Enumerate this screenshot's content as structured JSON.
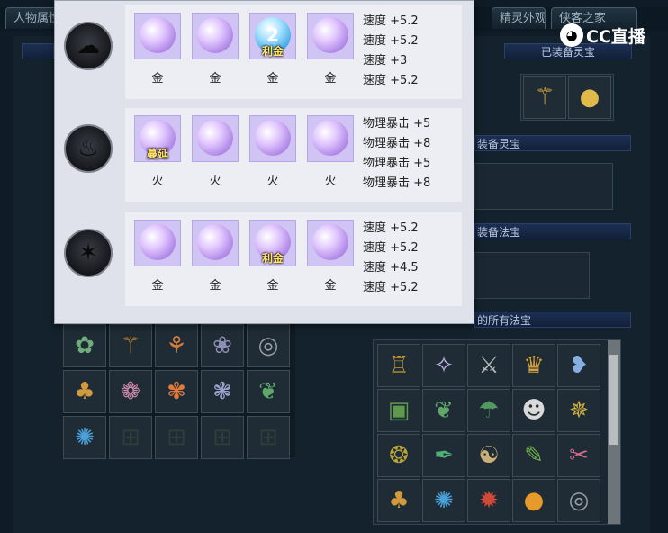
{
  "tabs": [
    "人物属性",
    "",
    "精灵外观",
    "侠客之家"
  ],
  "right_panel": {
    "equipped_lingbao_header": "已装备灵宝",
    "equip_lingbao_header": "装备灵宝",
    "equip_fabao_header": "装备法宝",
    "all_fabao_header": "的所有法宝"
  },
  "logo": {
    "text": "CC直播"
  },
  "popup": {
    "rows": [
      {
        "element_icon": "cloud-element-icon",
        "gems": [
          {
            "label": "金",
            "tag": "",
            "icon": "purple-orb-icon"
          },
          {
            "label": "金",
            "tag": "",
            "icon": "purple-orb-icon"
          },
          {
            "label": "金",
            "tag": "利金",
            "badge": "2",
            "icon": "blue-orb-icon"
          },
          {
            "label": "金",
            "tag": "",
            "icon": "purple-orb-icon"
          }
        ],
        "stats": [
          "速度 +5.2",
          "速度 +5.2",
          "速度 +3",
          "速度 +5.2"
        ]
      },
      {
        "element_icon": "fire-element-icon",
        "gems": [
          {
            "label": "火",
            "tag": "蔓延",
            "icon": "white-orb-icon"
          },
          {
            "label": "火",
            "tag": "",
            "icon": "purple-orb-icon"
          },
          {
            "label": "火",
            "tag": "",
            "icon": "purple-orb-icon"
          },
          {
            "label": "火",
            "tag": "",
            "icon": "purple-orb-icon"
          }
        ],
        "stats": [
          "物理暴击 +5",
          "物理暴击 +8",
          "物理暴击 +5",
          "物理暴击 +8"
        ]
      },
      {
        "element_icon": "fish-element-icon",
        "gems": [
          {
            "label": "金",
            "tag": "",
            "icon": "purple-orb-icon"
          },
          {
            "label": "金",
            "tag": "",
            "icon": "purple-orb-icon"
          },
          {
            "label": "金",
            "tag": "利金",
            "icon": "purple-orb-icon"
          },
          {
            "label": "金",
            "tag": "",
            "icon": "purple-orb-icon"
          }
        ],
        "stats": [
          "速度 +5.2",
          "速度 +5.2",
          "速度 +4.5",
          "速度 +5.2"
        ]
      }
    ]
  },
  "inventory_icons": [
    "jade-pendant-icon",
    "staff-icon",
    "scepter-icon",
    "grapes-icon",
    "ring-icon",
    "gourd-icon",
    "lotus-icon",
    "flower-icon",
    "cluster-icon",
    "leaf-icon",
    "dragon-icon",
    "locked-icon",
    "locked-icon",
    "locked-icon",
    "locked-icon"
  ],
  "fabao_icons": [
    "tripod-icon",
    "butterfly-icon",
    "sword-icon",
    "crown-icon",
    "bird-icon",
    "box-icon",
    "leaf-icon",
    "umbrella-icon",
    "mask-icon",
    "phoenix-icon",
    "seal-icon",
    "blade-icon",
    "taiji-icon",
    "bamboo-icon",
    "ribbon-icon",
    "gourd-icon",
    "dragon-icon",
    "coral-icon",
    "orb-icon",
    "ring-icon"
  ]
}
